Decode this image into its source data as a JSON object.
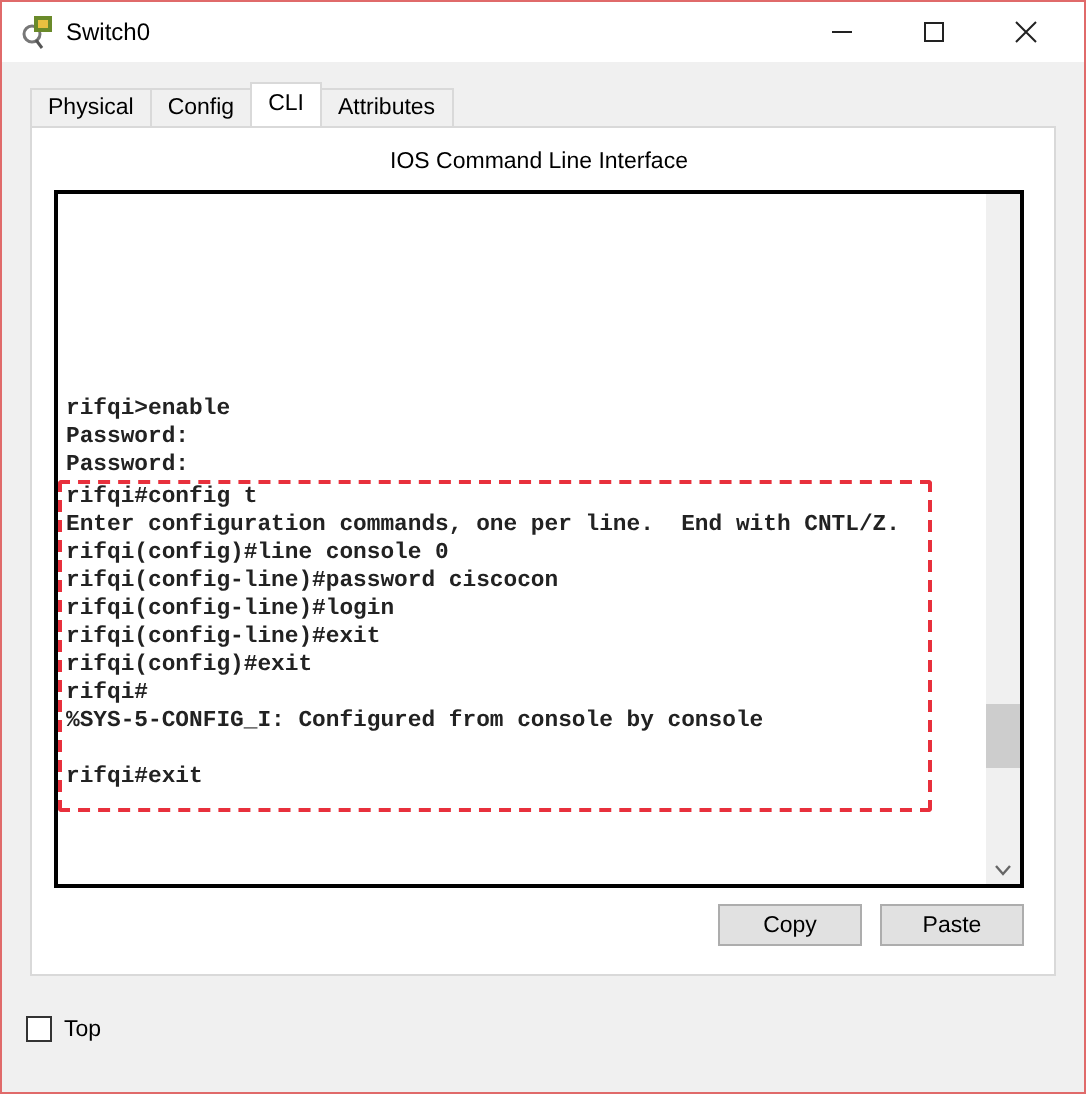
{
  "window": {
    "title": "Switch0"
  },
  "tabs": [
    {
      "label": "Physical",
      "selected": false
    },
    {
      "label": "Config",
      "selected": false
    },
    {
      "label": "CLI",
      "selected": true
    },
    {
      "label": "Attributes",
      "selected": false
    }
  ],
  "panel_title": "IOS Command Line Interface",
  "terminal": {
    "lines": [
      "rifqi>enable",
      "Password:",
      "Password:"
    ],
    "highlight": {
      "paragraphs": [
        [
          "rifqi#config t",
          "Enter configuration commands, one per line.  End with CNTL/Z.",
          "rifqi(config)#line console 0",
          "rifqi(config-line)#password ciscocon",
          "rifqi(config-line)#login",
          "rifqi(config-line)#exit",
          "rifqi(config)#exit",
          "rifqi#",
          "%SYS-5-CONFIG_I: Configured from console by console"
        ],
        [
          "rifqi#exit"
        ]
      ]
    }
  },
  "buttons": [
    "Copy",
    "Paste"
  ],
  "top_checkbox": {
    "label": "Top",
    "checked": false
  }
}
